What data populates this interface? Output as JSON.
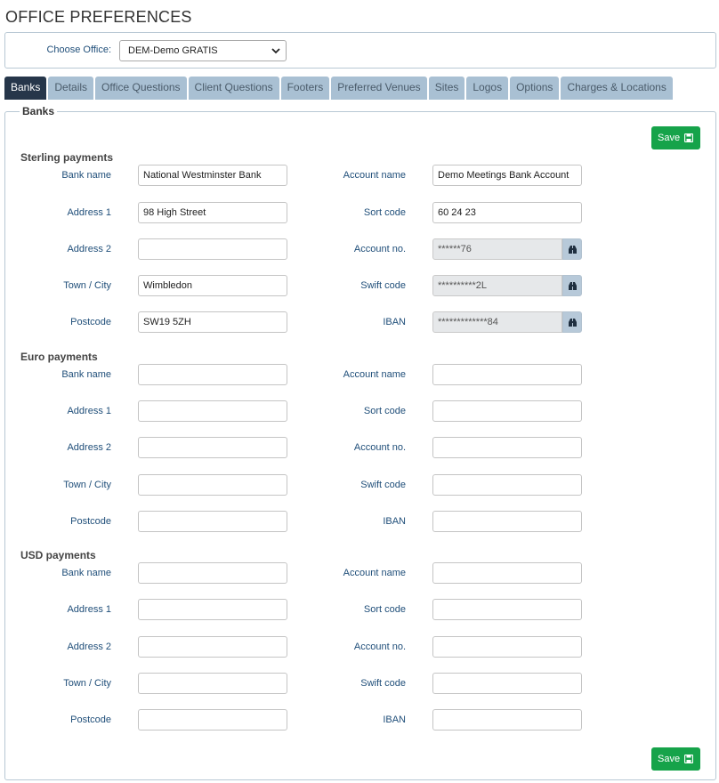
{
  "page": {
    "title": "OFFICE PREFERENCES"
  },
  "office": {
    "label": "Choose Office:",
    "selected": "DEM-Demo GRATIS"
  },
  "tabs": [
    {
      "label": "Banks",
      "active": true
    },
    {
      "label": "Details"
    },
    {
      "label": "Office Questions"
    },
    {
      "label": "Client Questions"
    },
    {
      "label": "Footers"
    },
    {
      "label": "Preferred Venues"
    },
    {
      "label": "Sites"
    },
    {
      "label": "Logos"
    },
    {
      "label": "Options"
    },
    {
      "label": "Charges & Locations"
    }
  ],
  "panel": {
    "legend": "Banks",
    "save_label": "Save"
  },
  "labels": {
    "bank_name": "Bank name",
    "address1": "Address 1",
    "address2": "Address 2",
    "town": "Town / City",
    "postcode": "Postcode",
    "account_name": "Account name",
    "sort_code": "Sort code",
    "account_no": "Account no.",
    "swift": "Swift code",
    "iban": "IBAN"
  },
  "sections": {
    "sterling": {
      "title": "Sterling payments",
      "bank_name": "National Westminster Bank",
      "address1": "98 High Street",
      "address2": "",
      "town": "Wimbledon",
      "postcode": "SW19 5ZH",
      "account_name": "Demo Meetings Bank Account",
      "sort_code": "60 24 23",
      "account_no": "******76",
      "swift": "**********2L",
      "iban": "*************84"
    },
    "euro": {
      "title": "Euro payments",
      "bank_name": "",
      "address1": "",
      "address2": "",
      "town": "",
      "postcode": "",
      "account_name": "",
      "sort_code": "",
      "account_no": "",
      "swift": "",
      "iban": ""
    },
    "usd": {
      "title": "USD payments",
      "bank_name": "",
      "address1": "",
      "address2": "",
      "town": "",
      "postcode": "",
      "account_name": "",
      "sort_code": "",
      "account_no": "",
      "swift": "",
      "iban": ""
    }
  },
  "colors": {
    "accent": "#26364a",
    "tab": "#a9c0d3",
    "save": "#16a34a",
    "label": "#1f4e79"
  },
  "icons": {
    "save": "floppy-disk-icon",
    "reveal": "binoculars-icon",
    "dropdown": "chevron-down-icon"
  }
}
